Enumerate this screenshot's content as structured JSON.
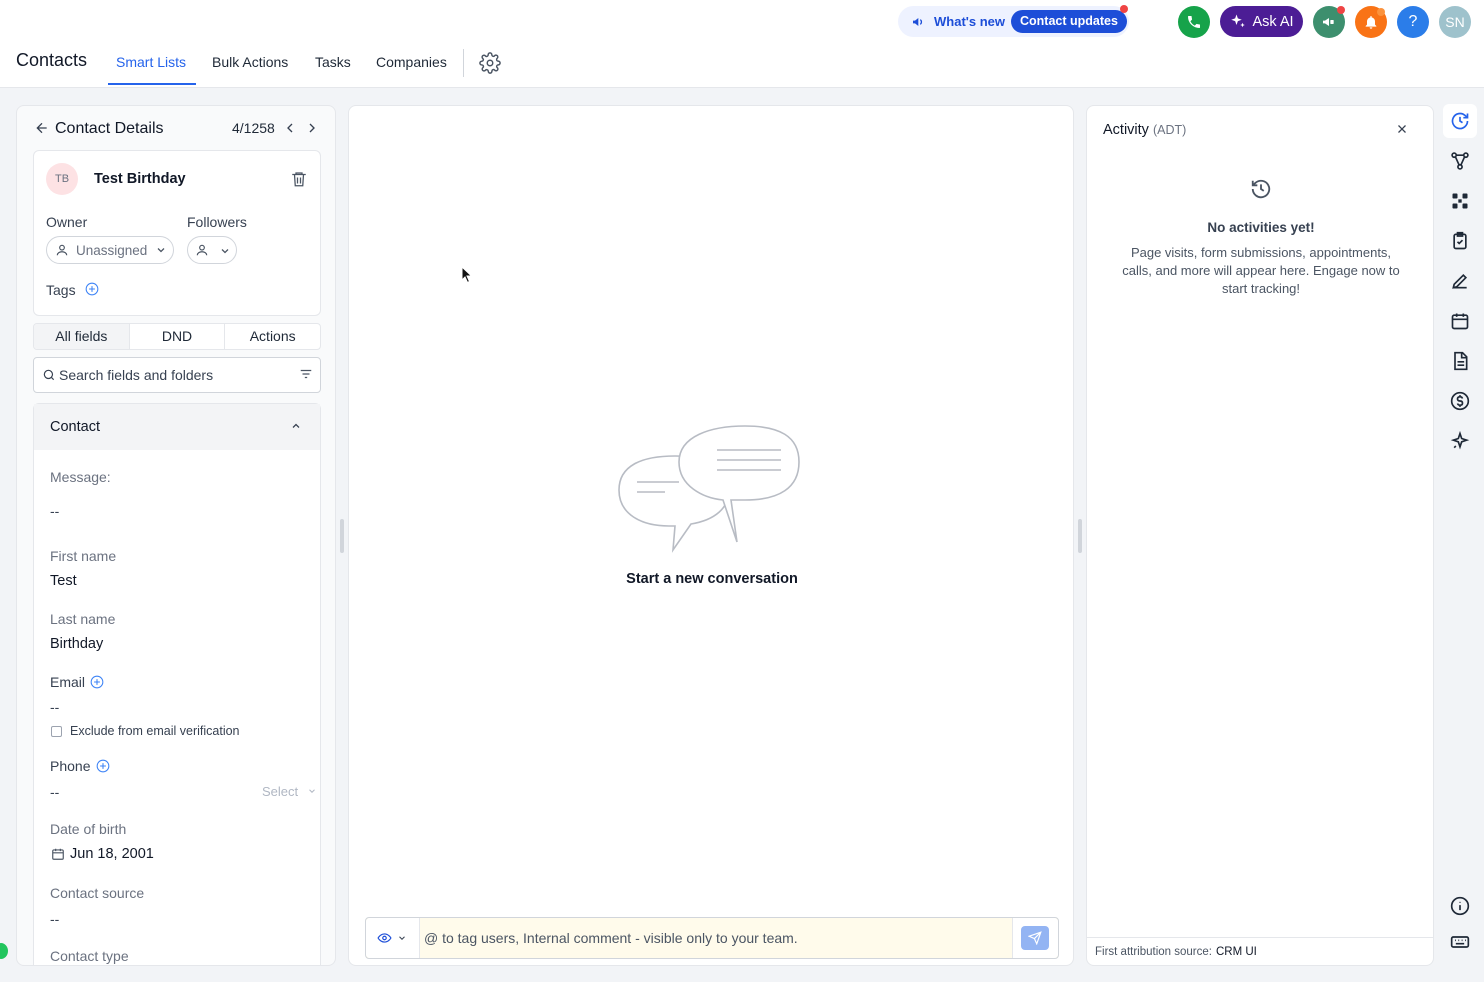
{
  "header": {
    "title": "Contacts",
    "tabs": [
      {
        "label": "Smart Lists",
        "active": true
      },
      {
        "label": "Bulk Actions",
        "active": false
      },
      {
        "label": "Tasks",
        "active": false
      },
      {
        "label": "Companies",
        "active": false
      }
    ],
    "whats_new_label": "What's new",
    "contact_updates_label": "Contact updates",
    "ask_ai_label": "Ask AI",
    "help_label": "?",
    "user_initials": "SN",
    "colors": {
      "accent": "#2563eb",
      "phone": "#16a34a",
      "ask_ai": "#4c1d95",
      "announce": "#3d8f6e",
      "bell": "#f97316",
      "help": "#2b7de9"
    }
  },
  "contact_details": {
    "title": "Contact Details",
    "position": "4/1258",
    "contact": {
      "initials": "TB",
      "name": "Test Birthday"
    },
    "owner_label": "Owner",
    "owner_value": "Unassigned",
    "followers_label": "Followers",
    "tags_label": "Tags",
    "field_tabs": [
      {
        "label": "All fields",
        "active": true
      },
      {
        "label": "DND",
        "active": false
      },
      {
        "label": "Actions",
        "active": false
      }
    ],
    "search_placeholder": "Search fields and folders",
    "section_title": "Contact",
    "fields": {
      "message": {
        "label": "Message:",
        "value": "--"
      },
      "first_name": {
        "label": "First name",
        "value": "Test"
      },
      "last_name": {
        "label": "Last name",
        "value": "Birthday"
      },
      "email": {
        "label": "Email",
        "value": "--",
        "exclude_label": "Exclude from email verification"
      },
      "phone": {
        "label": "Phone",
        "value": "--",
        "select_label": "Select"
      },
      "dob": {
        "label": "Date of birth",
        "value": "Jun 18, 2001"
      },
      "contact_source": {
        "label": "Contact source",
        "value": "--"
      },
      "contact_type": {
        "label": "Contact type"
      }
    }
  },
  "conversation": {
    "empty_title": "Start a new conversation",
    "composer_placeholder": "@ to tag users, Internal comment - visible only to your team."
  },
  "activity": {
    "title": "Activity",
    "subtitle": "(ADT)",
    "empty_title": "No activities yet!",
    "empty_desc": "Page visits, form submissions, appointments, calls, and more will appear here. Engage now to start tracking!",
    "footer_label": "First attribution source:",
    "footer_value": "CRM UI"
  },
  "rail_icons": [
    "activity-icon",
    "workflow-icon",
    "network-icon",
    "task-icon",
    "notes-icon",
    "calendar-icon",
    "document-icon",
    "payment-icon",
    "ai-sparkle-icon",
    "info-icon",
    "keyboard-icon"
  ]
}
